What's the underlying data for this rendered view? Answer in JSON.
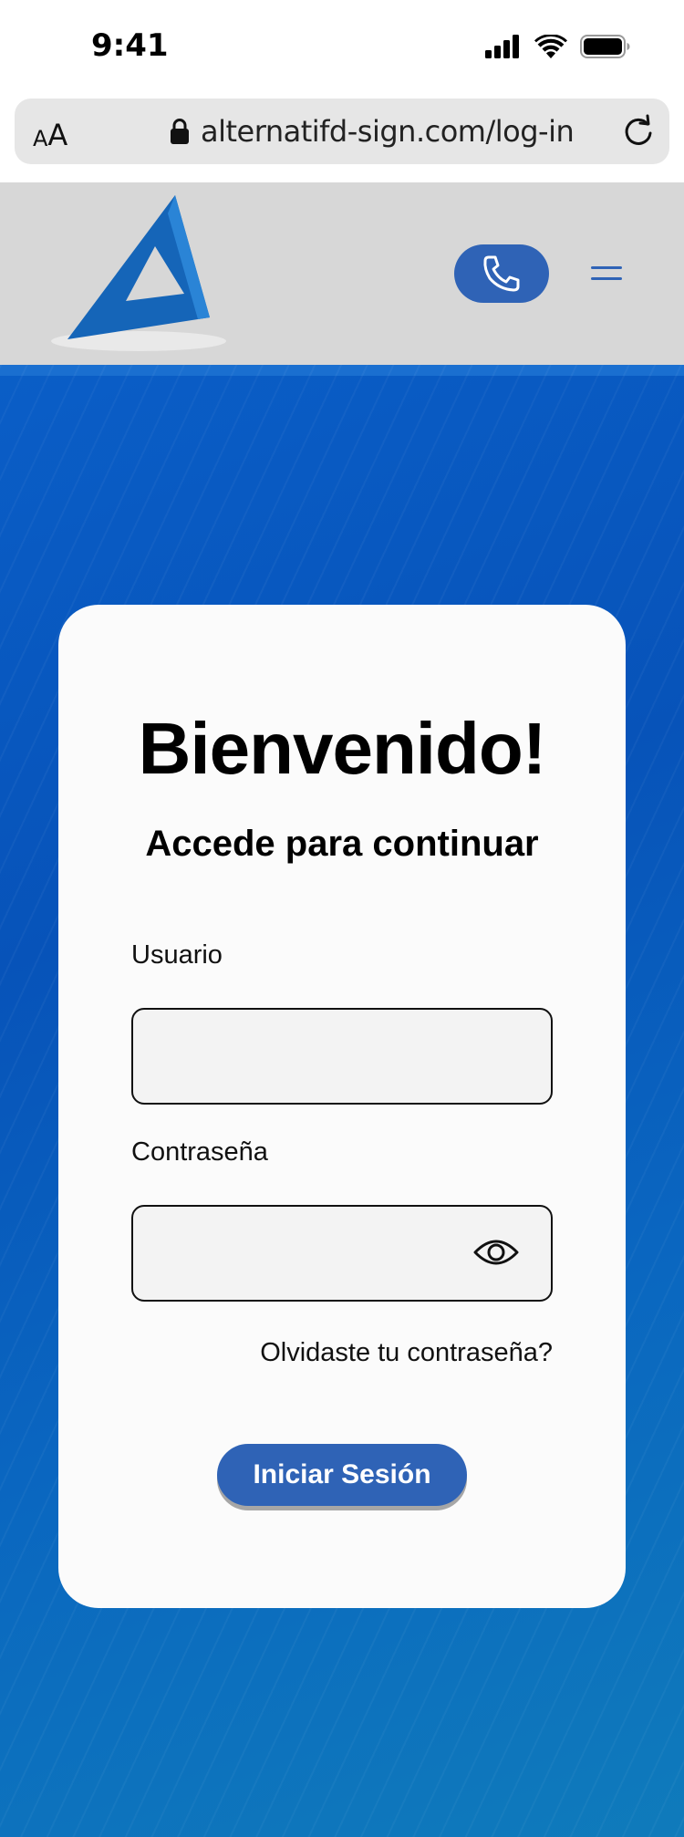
{
  "status_bar": {
    "time": "9:41",
    "icons": [
      "signal-icon",
      "wifi-icon",
      "battery-icon"
    ]
  },
  "browser": {
    "text_size_small": "A",
    "text_size_large": "A",
    "url": "alternatifd-sign.com/log-in",
    "icons": [
      "lock-icon",
      "reload-icon"
    ]
  },
  "header": {
    "logo_icon": "brand-logo-icon",
    "call_icon": "phone-icon",
    "menu_icon": "hamburger-menu-icon"
  },
  "login": {
    "title": "Bienvenido!",
    "subtitle": "Accede para continuar",
    "username_label": "Usuario",
    "username_value": "",
    "password_label": "Contraseña",
    "password_value": "",
    "show_password_icon": "eye-icon",
    "forgot_link": "Olvidaste tu contraseña?",
    "submit_label": "Iniciar Sesión"
  },
  "colors": {
    "brand_blue": "#2f63b6",
    "hero_blue": "#0753b9",
    "header_gray": "#d7d7d7",
    "card_white": "#fbfbfb"
  }
}
